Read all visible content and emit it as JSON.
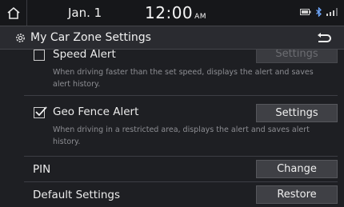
{
  "status": {
    "date": "Jan.  1",
    "time": "12:00",
    "ampm": "AM"
  },
  "header": {
    "title": "My Car Zone Settings"
  },
  "items": [
    {
      "title": "Speed Alert",
      "checked": false,
      "description": "When driving faster than the set speed, displays the alert and saves alert history.",
      "button": "Settings",
      "button_enabled": false
    },
    {
      "title": "Geo Fence Alert",
      "checked": true,
      "description": "When driving in a restricted area, displays the alert and saves alert history.",
      "button": "Settings",
      "button_enabled": true
    },
    {
      "title": "PIN",
      "button": "Change"
    },
    {
      "title": "Default Settings",
      "button": "Restore"
    }
  ],
  "icons": {
    "home": "home-icon",
    "settings": "gear-icon",
    "back": "back-arrow-icon"
  },
  "colors": {
    "background": "#1e1f23",
    "button": "#3f4045",
    "text": "#e6e6e6",
    "description": "#8d8e93"
  }
}
